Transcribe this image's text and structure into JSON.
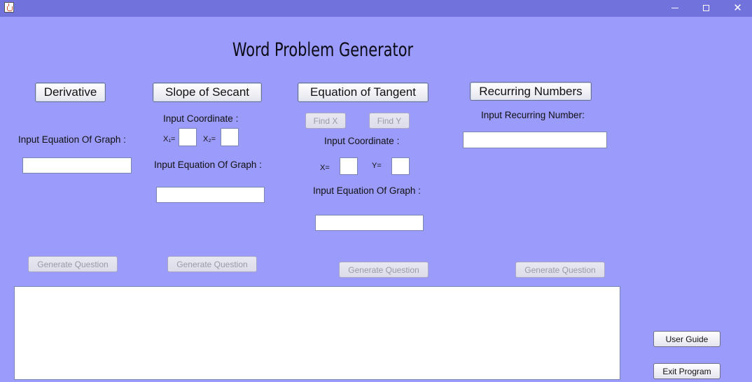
{
  "window": {
    "title_bar_text": "",
    "minimize_label": "",
    "maximize_label": "",
    "close_label": "✕"
  },
  "app_title": "Word Problem Generator",
  "derivative": {
    "button_label": "Derivative",
    "equation_label": "Input Equation Of Graph :",
    "equation_value": "",
    "generate_label": "Generate Question"
  },
  "secant": {
    "button_label": "Slope of Secant",
    "coordinate_label": "Input Coordinate :",
    "x1_label": "X₁=",
    "x1_value": "",
    "x2_label": "X₂=",
    "x2_value": "",
    "equation_label": "Input Equation Of Graph :",
    "equation_value": "",
    "generate_label": "Generate Question"
  },
  "tangent": {
    "button_label": "Equation of Tangent",
    "find_x_label": "Find X",
    "find_y_label": "Find Y",
    "coordinate_label": "Input Coordinate :",
    "x_label": "X=",
    "x_value": "",
    "y_label": "Y=",
    "y_value": "",
    "equation_label": "Input Equation Of Graph :",
    "equation_value": "",
    "generate_label": "Generate Question"
  },
  "recurring": {
    "button_label": "Recurring Numbers",
    "input_label": "Input Recurring Number:",
    "input_value": "",
    "generate_label": "Generate Question"
  },
  "output": {
    "text": ""
  },
  "side": {
    "user_guide_label": "User Guide",
    "exit_label": "Exit Program"
  },
  "colors": {
    "background": "#9b9bfb",
    "titlebar": "#7272dc"
  }
}
